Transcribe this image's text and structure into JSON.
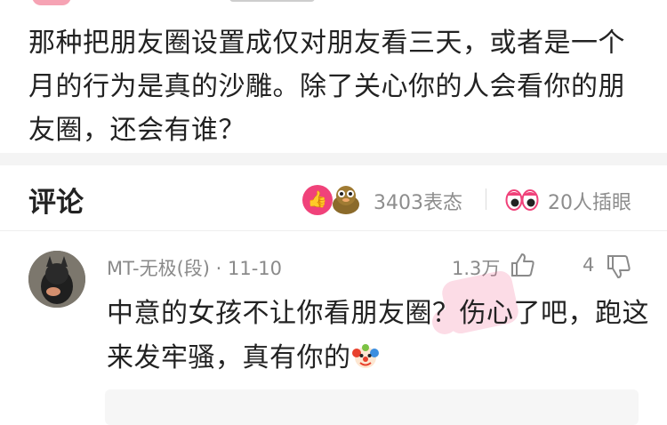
{
  "post": {
    "text": "那种把朋友圈设置成仅对朋友看三天，或者是一个月的行为是真的沙雕。除了关心你的人会看你的朋友圈，还会有谁？"
  },
  "comments_header": {
    "title": "评论",
    "reactions_count": "3403表态",
    "eyes_count": "20人插眼"
  },
  "comment": {
    "author": "MT-无极(段) · 11-10",
    "likes": "1.3万",
    "dislikes": "4",
    "text": "中意的女孩不让你看朋友圈？伤心了吧，跑这来发牢骚，真有你的",
    "emoji_icon": "clown-icon"
  },
  "colors": {
    "accent": "#f0427a",
    "muted": "#8a8a8a",
    "band": "#f4f4f4"
  }
}
